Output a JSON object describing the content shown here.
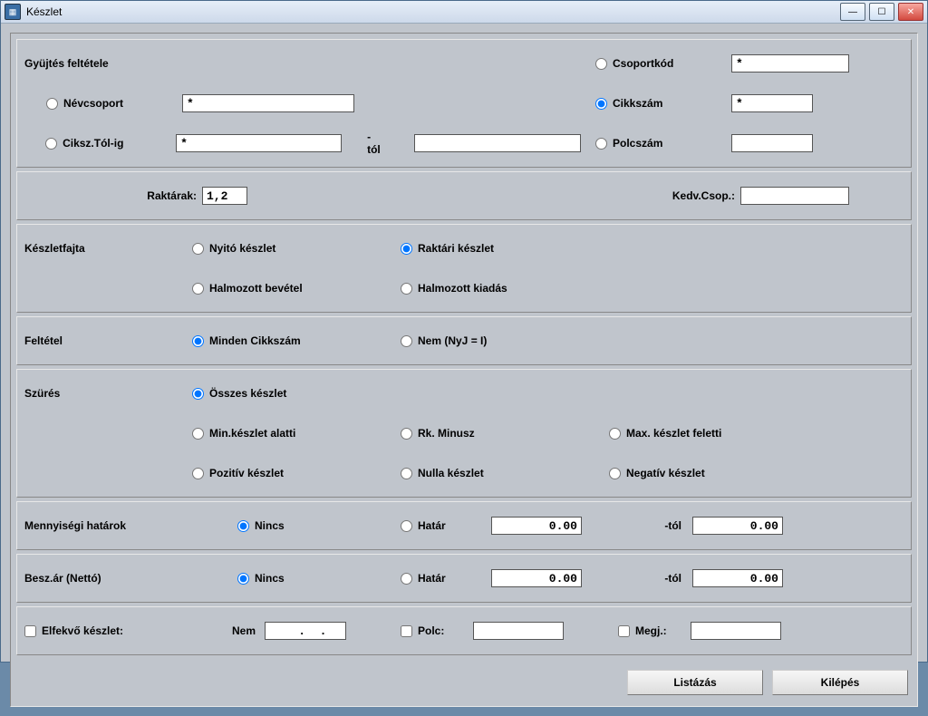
{
  "title": "Készlet",
  "section_gyujtes": "Gyüjtés feltétele",
  "rad": {
    "nevcsoport": "Névcsoport",
    "ciksz_tol_ig": "Ciksz.Tól-ig",
    "csoportkod": "Csoportkód",
    "cikkszam": "Cikkszám",
    "polcszam": "Polcszám"
  },
  "vals": {
    "nevcsoport": "*",
    "ciksz_tol": "*",
    "ciksz_ig": "",
    "csoportkod": "*",
    "cikkszam": "*",
    "polcszam": ""
  },
  "tol_lbl": "-tól",
  "raktarak_lbl": "Raktárak:",
  "raktarak_val": "1,2",
  "kedvcsop_lbl": "Kedv.Csop.:",
  "kedvcsop_val": "",
  "keszletfajta_lbl": "Készletfajta",
  "keszletfajta": {
    "nyito": "Nyitó készlet",
    "raktari": "Raktári készlet",
    "halm_be": "Halmozott bevétel",
    "halm_ki": "Halmozott kiadás"
  },
  "feltetel_lbl": "Feltétel",
  "feltetel": {
    "minden": "Minden Cikkszám",
    "nem": "Nem (NyJ = I)"
  },
  "szures_lbl": "Szürés",
  "szures": {
    "osszes": "Összes készlet",
    "min": "Min.készlet alatti",
    "rk_minusz": "Rk. Minusz",
    "max": "Max. készlet feletti",
    "pozitiv": "Pozitív készlet",
    "nulla": "Nulla készlet",
    "negativ": "Negatív készlet"
  },
  "menny_lbl": "Mennyiségi határok",
  "besz_lbl": "Besz.ár (Nettó)",
  "nincs": "Nincs",
  "hatar": "Határ",
  "hatar_val": "0.00",
  "tol_suffix": "-tól",
  "tol_val": "0.00",
  "elfekvo_lbl": "Elfekvő készlet:",
  "nem_lbl": "Nem",
  "nem_val": "  .  .",
  "polc_lbl": "Polc:",
  "polc_val": "",
  "megj_lbl": "Megj.:",
  "megj_val": "",
  "btn_list": "Listázás",
  "btn_exit": "Kilépés"
}
